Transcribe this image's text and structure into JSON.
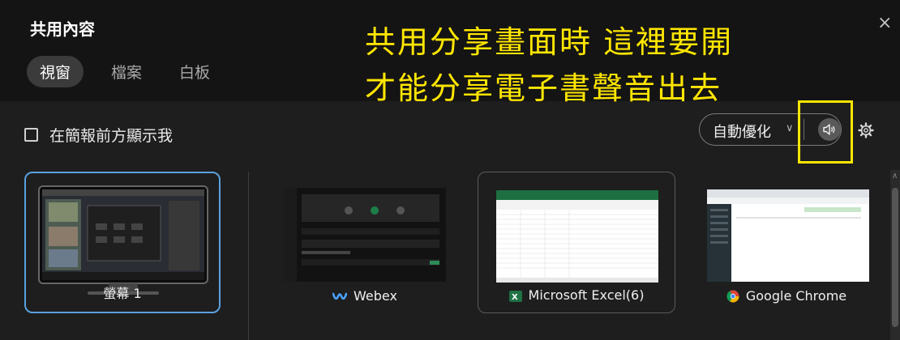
{
  "dialog": {
    "title": "共用內容",
    "close_label": "×"
  },
  "tabs": [
    {
      "label": "視窗",
      "active": true
    },
    {
      "label": "檔案",
      "active": false
    },
    {
      "label": "白板",
      "active": false
    }
  ],
  "annotation": {
    "line1": "共用分享畫面時 這裡要開",
    "line2": "才能分享電子書聲音出去",
    "color": "#ffe600"
  },
  "show_me_checkbox": {
    "label": "在簡報前方顯示我",
    "checked": false
  },
  "quality": {
    "label": "自動優化",
    "chevron": "chevron-down-icon"
  },
  "audio_button": {
    "icon": "speaker-icon"
  },
  "settings_button": {
    "icon": "gear-icon"
  },
  "cards": [
    {
      "label": "螢幕 1",
      "selected": true,
      "icon": "monitor-icon"
    },
    {
      "label": "Webex",
      "icon": "webex-icon"
    },
    {
      "label": "Microsoft Excel(6)",
      "icon": "excel-icon"
    },
    {
      "label": "Google Chrome",
      "icon": "chrome-icon"
    }
  ],
  "colors": {
    "accent": "#5aa1e0",
    "highlight": "#ffe600",
    "background": "#1e1e1e"
  }
}
